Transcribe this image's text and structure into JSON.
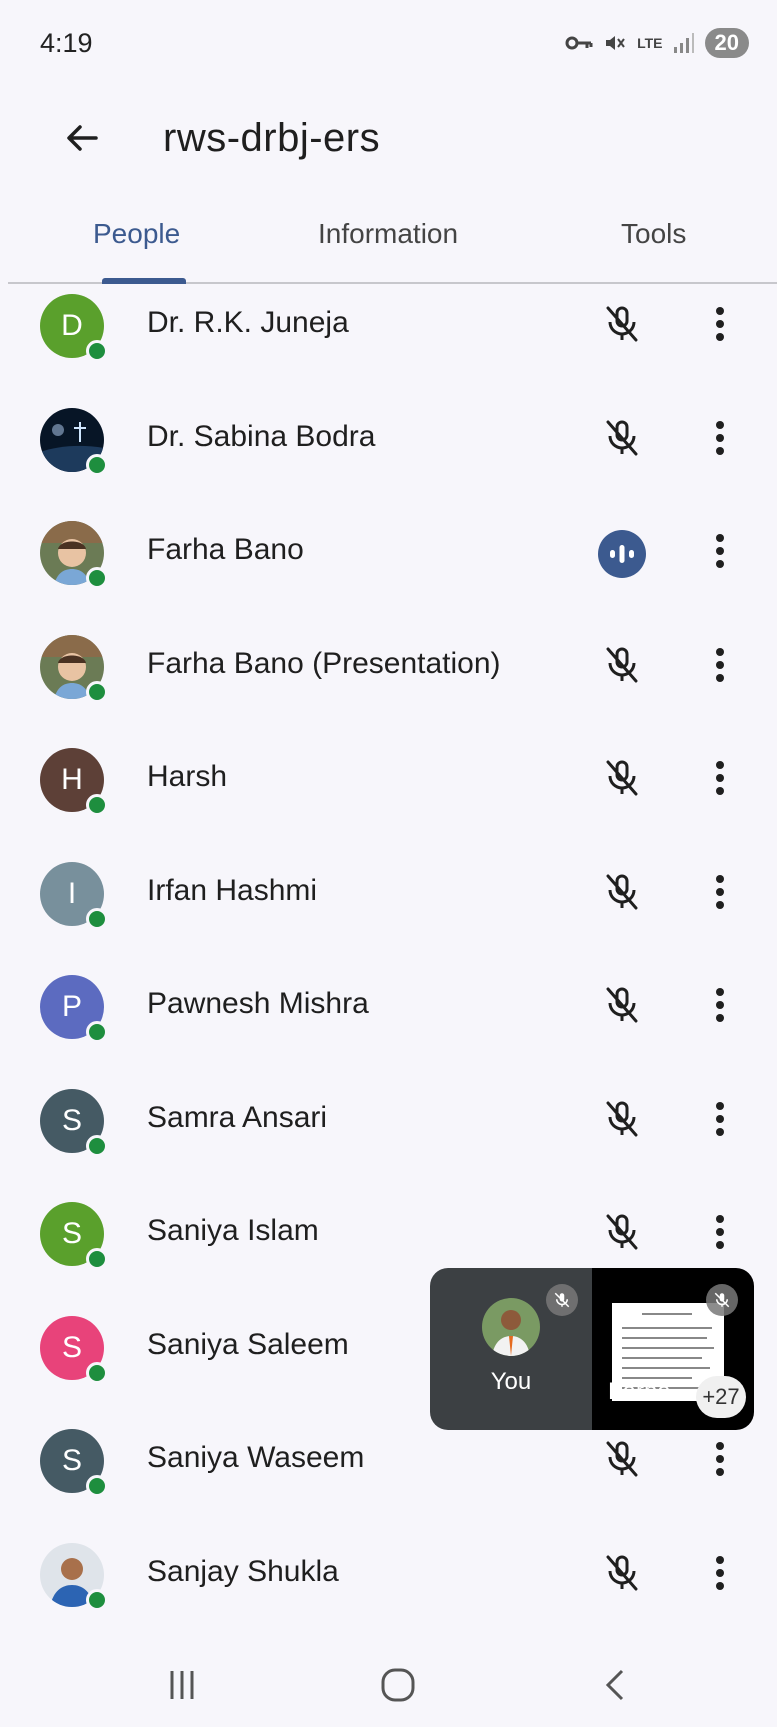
{
  "status_bar": {
    "time": "4:19",
    "battery": "20",
    "network": "LTE"
  },
  "header": {
    "title": "rws-drbj-ers"
  },
  "tabs": [
    {
      "label": "People",
      "active": true
    },
    {
      "label": "Information",
      "active": false
    },
    {
      "label": "Tools",
      "active": false
    }
  ],
  "participants": [
    {
      "name": "Dr. R.K. Juneja",
      "initial": "D",
      "avatar_color": "#5aa02c",
      "mic": "muted"
    },
    {
      "name": "Dr. Sabina Bodra",
      "initial": "",
      "avatar_color": "#0b1a2b",
      "mic": "muted"
    },
    {
      "name": "Farha Bano",
      "initial": "",
      "avatar_color": "#c9a27b",
      "mic": "speaking"
    },
    {
      "name": "Farha Bano (Presentation)",
      "initial": "",
      "avatar_color": "#c9a27b",
      "mic": "muted"
    },
    {
      "name": "Harsh",
      "initial": "H",
      "avatar_color": "#5d4037",
      "mic": "muted"
    },
    {
      "name": "Irfan Hashmi",
      "initial": "I",
      "avatar_color": "#78909c",
      "mic": "muted"
    },
    {
      "name": "Pawnesh Mishra",
      "initial": "P",
      "avatar_color": "#5c6bc0",
      "mic": "muted"
    },
    {
      "name": "Samra Ansari",
      "initial": "S",
      "avatar_color": "#455a64",
      "mic": "muted"
    },
    {
      "name": "Saniya Islam",
      "initial": "S",
      "avatar_color": "#5aa02c",
      "mic": "muted"
    },
    {
      "name": "Saniya Saleem",
      "initial": "S",
      "avatar_color": "#e8437a",
      "mic": "muted"
    },
    {
      "name": "Saniya Waseem",
      "initial": "S",
      "avatar_color": "#455a64",
      "mic": "muted"
    },
    {
      "name": "Sanjay Shukla",
      "initial": "",
      "avatar_color": "#3b6ea5",
      "mic": "muted"
    }
  ],
  "pip": {
    "self_label": "You",
    "other_label": "Farha",
    "extra_count": "+27"
  },
  "colors": {
    "accent": "#3c5a8f",
    "online": "#1e8e3e",
    "pip_bg": "#3c4043"
  }
}
